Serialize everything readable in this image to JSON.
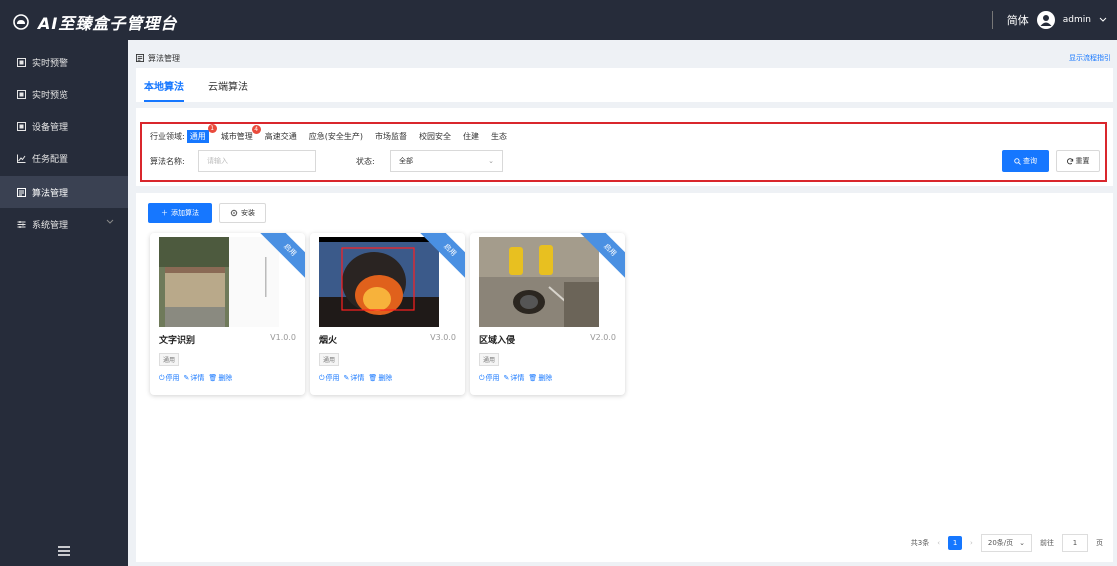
{
  "app": {
    "title": "AI至臻盒子管理台",
    "lang": "简体",
    "user": "admin"
  },
  "sidebar": {
    "items": [
      {
        "label": "实时预警",
        "icon": "monitor-icon"
      },
      {
        "label": "实时预览",
        "icon": "monitor-icon"
      },
      {
        "label": "设备管理",
        "icon": "monitor-icon"
      },
      {
        "label": "任务配置",
        "icon": "chart-line-icon"
      },
      {
        "label": "算法管理",
        "icon": "algorithm-icon",
        "active": true
      },
      {
        "label": "系统管理",
        "icon": "settings-sliders-icon",
        "has_children": true
      }
    ]
  },
  "breadcrumb": "算法管理",
  "guide_link": "显示流程指引",
  "tabs": [
    {
      "label": "本地算法",
      "active": true
    },
    {
      "label": "云端算法"
    }
  ],
  "filters": {
    "industry_label": "行业领域:",
    "industries": [
      {
        "label": "通用",
        "selected": true,
        "badge": "1"
      },
      {
        "label": "城市管理",
        "badge": "4"
      },
      {
        "label": "高速交通"
      },
      {
        "label": "应急(安全生产)"
      },
      {
        "label": "市场监督"
      },
      {
        "label": "校园安全"
      },
      {
        "label": "住建"
      },
      {
        "label": "生态"
      }
    ],
    "name_label": "算法名称:",
    "name_placeholder": "请输入",
    "status_label": "状态:",
    "status_value": "全部",
    "search_button": "查询",
    "reset_button": "重置"
  },
  "toolbar": {
    "add": "添加算法",
    "install": "安装"
  },
  "cards": [
    {
      "title": "文字识别",
      "version": "V1.0.0",
      "tag": "通用",
      "ribbon": "启用",
      "actions": [
        "停用",
        "详情",
        "删除"
      ]
    },
    {
      "title": "烟火",
      "version": "V3.0.0",
      "tag": "通用",
      "ribbon": "启用",
      "actions": [
        "停用",
        "详情",
        "删除"
      ]
    },
    {
      "title": "区域入侵",
      "version": "V2.0.0",
      "tag": "通用",
      "ribbon": "启用",
      "actions": [
        "停用",
        "详情",
        "删除"
      ]
    }
  ],
  "pagination": {
    "total": "共3条",
    "current": "1",
    "page_size": "20条/页",
    "goto_prefix": "前往",
    "goto_value": "1",
    "goto_suffix": "页"
  },
  "colors": {
    "primary": "#1677ff",
    "sidebar_bg": "#262c3a",
    "highlight_border": "#d9262c"
  }
}
